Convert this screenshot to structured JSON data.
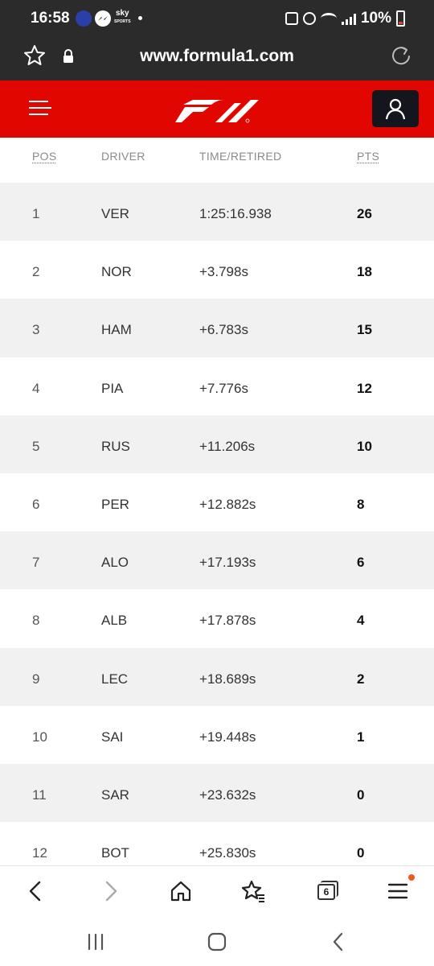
{
  "status_bar": {
    "time": "16:58",
    "sky_label": "sky",
    "sky_sub": "SPORTS",
    "battery": "10%"
  },
  "browser": {
    "url": "www.formula1.com"
  },
  "table": {
    "headers": {
      "pos": "POS",
      "driver": "DRIVER",
      "time": "TIME/RETIRED",
      "pts": "PTS"
    },
    "rows": [
      {
        "pos": "1",
        "driver": "VER",
        "time": "1:25:16.938",
        "pts": "26"
      },
      {
        "pos": "2",
        "driver": "NOR",
        "time": "+3.798s",
        "pts": "18"
      },
      {
        "pos": "3",
        "driver": "HAM",
        "time": "+6.783s",
        "pts": "15"
      },
      {
        "pos": "4",
        "driver": "PIA",
        "time": "+7.776s",
        "pts": "12"
      },
      {
        "pos": "5",
        "driver": "RUS",
        "time": "+11.206s",
        "pts": "10"
      },
      {
        "pos": "6",
        "driver": "PER",
        "time": "+12.882s",
        "pts": "8"
      },
      {
        "pos": "7",
        "driver": "ALO",
        "time": "+17.193s",
        "pts": "6"
      },
      {
        "pos": "8",
        "driver": "ALB",
        "time": "+17.878s",
        "pts": "4"
      },
      {
        "pos": "9",
        "driver": "LEC",
        "time": "+18.689s",
        "pts": "2"
      },
      {
        "pos": "10",
        "driver": "SAI",
        "time": "+19.448s",
        "pts": "1"
      },
      {
        "pos": "11",
        "driver": "SAR",
        "time": "+23.632s",
        "pts": "0"
      },
      {
        "pos": "12",
        "driver": "BOT",
        "time": "+25.830s",
        "pts": "0"
      }
    ]
  },
  "bottom_nav": {
    "tab_count": "6"
  },
  "colors": {
    "brand_red": "#e10600",
    "dark_bar": "#2b2b2b",
    "row_shade": "#f1f1f1",
    "notification": "#f05a1a"
  },
  "icons": {
    "status": [
      "uefa-app-icon",
      "messenger-icon",
      "sky-sports-icon",
      "alarm-icon",
      "wifi-icon",
      "signal-icon",
      "battery-icon"
    ],
    "browser": [
      "star-icon",
      "lock-icon",
      "reload-icon"
    ],
    "nav": [
      "back-icon",
      "forward-icon",
      "home-icon",
      "bookmarks-icon",
      "tabs-icon",
      "menu-icon"
    ]
  }
}
